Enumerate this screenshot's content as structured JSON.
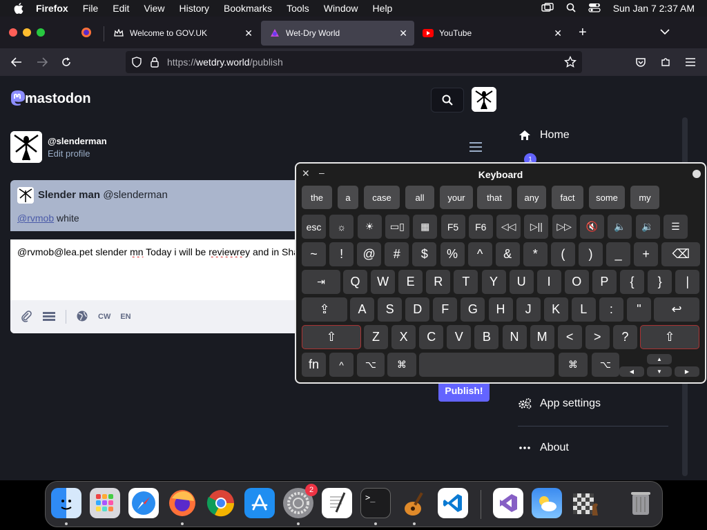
{
  "menubar": {
    "app": "Firefox",
    "items": [
      "File",
      "Edit",
      "View",
      "History",
      "Bookmarks",
      "Tools",
      "Window",
      "Help"
    ],
    "datetime": "Sun Jan 7  2:37 AM"
  },
  "tabs": [
    {
      "title": "Welcome to GOV.UK",
      "icon": "crown-icon"
    },
    {
      "title": "Wet-Dry World",
      "icon": "mastodon-icon",
      "active": true
    },
    {
      "title": "YouTube",
      "icon": "youtube-icon"
    }
  ],
  "url": {
    "prefix": "https://",
    "domain": "wetdry.world",
    "path": "/publish"
  },
  "page": {
    "logo_text": "mastodon",
    "handle": "@slenderman",
    "edit_profile": "Edit profile",
    "reply": {
      "display_name": "Slender man",
      "acct": "@slenderman",
      "mention": "@rvmob",
      "text": " white"
    },
    "compose": {
      "text_before": "@rvmob@lea.pet slender ",
      "typo1": "mn",
      "text_mid": " Today i will be ",
      "typo2": "reviewrey",
      "text_after": " and in Sha",
      "cw": "CW",
      "lang": "EN"
    },
    "publish": "Publish!",
    "nav": {
      "home": "Home",
      "badge": "1",
      "app_settings": "App settings",
      "about": "About"
    }
  },
  "keyboard": {
    "title": "Keyboard",
    "suggestions": [
      "the",
      "a",
      "case",
      "all",
      "your",
      "that",
      "any",
      "fact",
      "some",
      "my"
    ],
    "fn_row": [
      "esc",
      "☼",
      "☀",
      "▭▯",
      "▦",
      "F5",
      "F6",
      "◁◁",
      "▷||",
      "▷▷",
      "🔇",
      "🔈",
      "🔉",
      "☰"
    ],
    "num_row": [
      "~",
      "!",
      "@",
      "#",
      "$",
      "%",
      "^",
      "&",
      "*",
      "(",
      ")",
      "_",
      "+",
      "⌫"
    ],
    "top_row": [
      "⇥",
      "Q",
      "W",
      "E",
      "R",
      "T",
      "Y",
      "U",
      "I",
      "O",
      "P",
      "{",
      "}",
      "|"
    ],
    "home_row": [
      "⇪",
      "A",
      "S",
      "D",
      "F",
      "G",
      "H",
      "J",
      "K",
      "L",
      ":",
      "\"",
      "↩"
    ],
    "bottom_row": [
      "⇧",
      "Z",
      "X",
      "C",
      "V",
      "B",
      "N",
      "M",
      "<",
      ">",
      "?",
      "⇧"
    ],
    "mod_row": [
      "fn",
      "^",
      "⌥",
      "⌘",
      "",
      "⌘",
      "⌥"
    ],
    "arrows": [
      "▲",
      "◀",
      "▼",
      "▶"
    ]
  },
  "dock": {
    "apps": [
      "Finder",
      "Launchpad",
      "Safari",
      "Firefox",
      "Chrome",
      "App Store",
      "System Settings",
      "TextEdit",
      "Terminal",
      "GarageBand",
      "VS Code",
      "Visual Studio",
      "Weather",
      "Chess",
      "Trash"
    ],
    "badge": "2"
  }
}
